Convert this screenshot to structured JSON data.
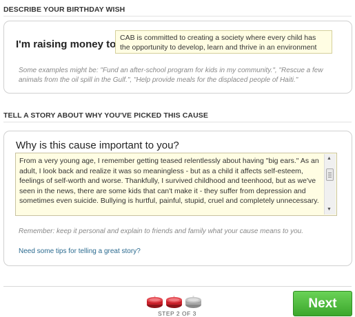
{
  "wish": {
    "section_title": "DESCRIBE YOUR BIRTHDAY WISH",
    "raise_label": "I'm raising money to",
    "cause_value": "CAB is committed to creating a society where every child has the opportunity to develop, learn and thrive in an environment",
    "examples": "Some examples might be: \"Fund an after-school program for kids in my community.\", \"Rescue a few animals from the oil spill in the Gulf.\", \"Help provide meals for the displaced people of Haiti.\""
  },
  "story": {
    "section_title": "TELL A STORY ABOUT WHY YOU'VE PICKED THIS CAUSE",
    "question": "Why is this cause important to you?",
    "text": "From a very young age, I remember getting teased relentlessly about having \"big ears.\" As an adult, I look back and realize it was so meaningless - but as a child it affects self-esteem, feelings of self-worth and worse. Thankfully, I survived childhood and teenhood, but as we've seen in the news, there are some kids that can't make it - they suffer from depression and sometimes even suicide. Bullying is hurtful, painful, stupid, cruel and completely unnecessary.",
    "reminder": "Remember: keep it personal and explain to friends and family what your cause means to you.",
    "tips_link": "Need some tips for telling a great story?"
  },
  "footer": {
    "next_label": "Next",
    "step_text": "STEP 2 OF 3",
    "steps": [
      {
        "icon": "cake-icon",
        "state": "complete",
        "color": "#c8202a"
      },
      {
        "icon": "cake-icon",
        "state": "current",
        "color": "#c8202a"
      },
      {
        "icon": "cake-icon",
        "state": "upcoming",
        "color": "#a8a8a8"
      }
    ]
  }
}
